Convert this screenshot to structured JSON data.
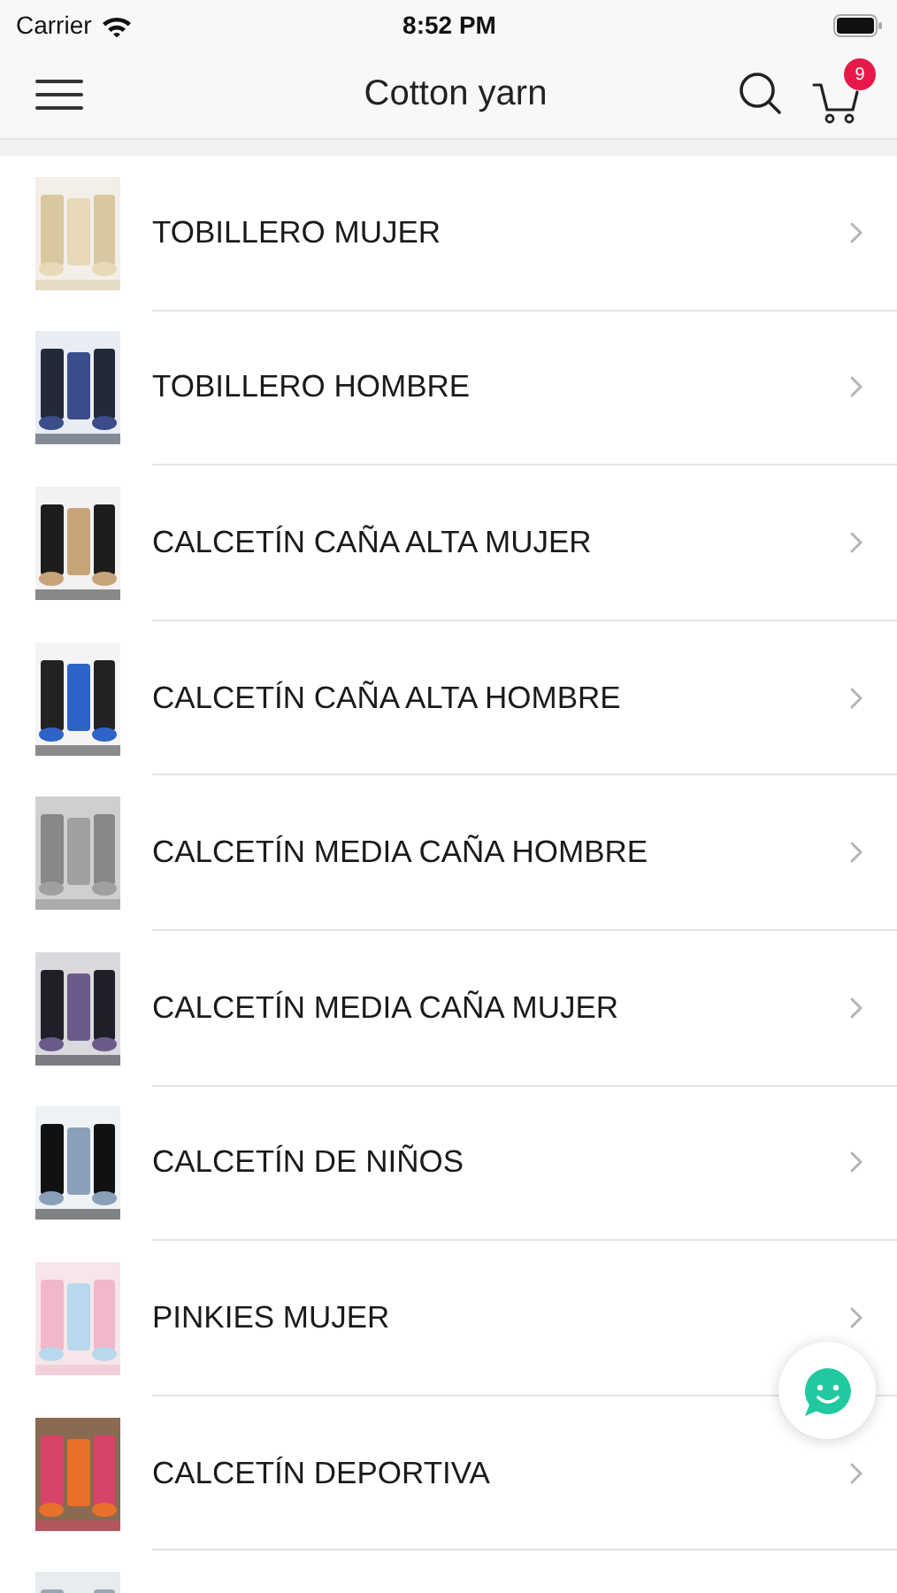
{
  "status_bar": {
    "carrier": "Carrier",
    "time": "8:52 PM"
  },
  "nav_bar": {
    "title": "Cotton yarn",
    "cart_count": "9"
  },
  "categories": [
    {
      "kind": "category",
      "label": "TOBILLERO MUJER"
    },
    {
      "kind": "category",
      "label": "TOBILLERO HOMBRE"
    },
    {
      "kind": "category",
      "label": "CALCETÍN CAÑA ALTA MUJER"
    },
    {
      "kind": "category",
      "label": "CALCETÍN CAÑA ALTA HOMBRE"
    },
    {
      "kind": "category",
      "label": "CALCETÍN MEDIA CAÑA HOMBRE"
    },
    {
      "kind": "category",
      "label": "CALCETÍN MEDIA CAÑA MUJER"
    },
    {
      "kind": "category",
      "label": "CALCETÍN DE NIÑOS"
    },
    {
      "kind": "category",
      "label": "PINKIES MUJER"
    },
    {
      "kind": "category",
      "label": "CALCETÍN DEPORTIVA"
    },
    {
      "kind": "partial"
    }
  ]
}
